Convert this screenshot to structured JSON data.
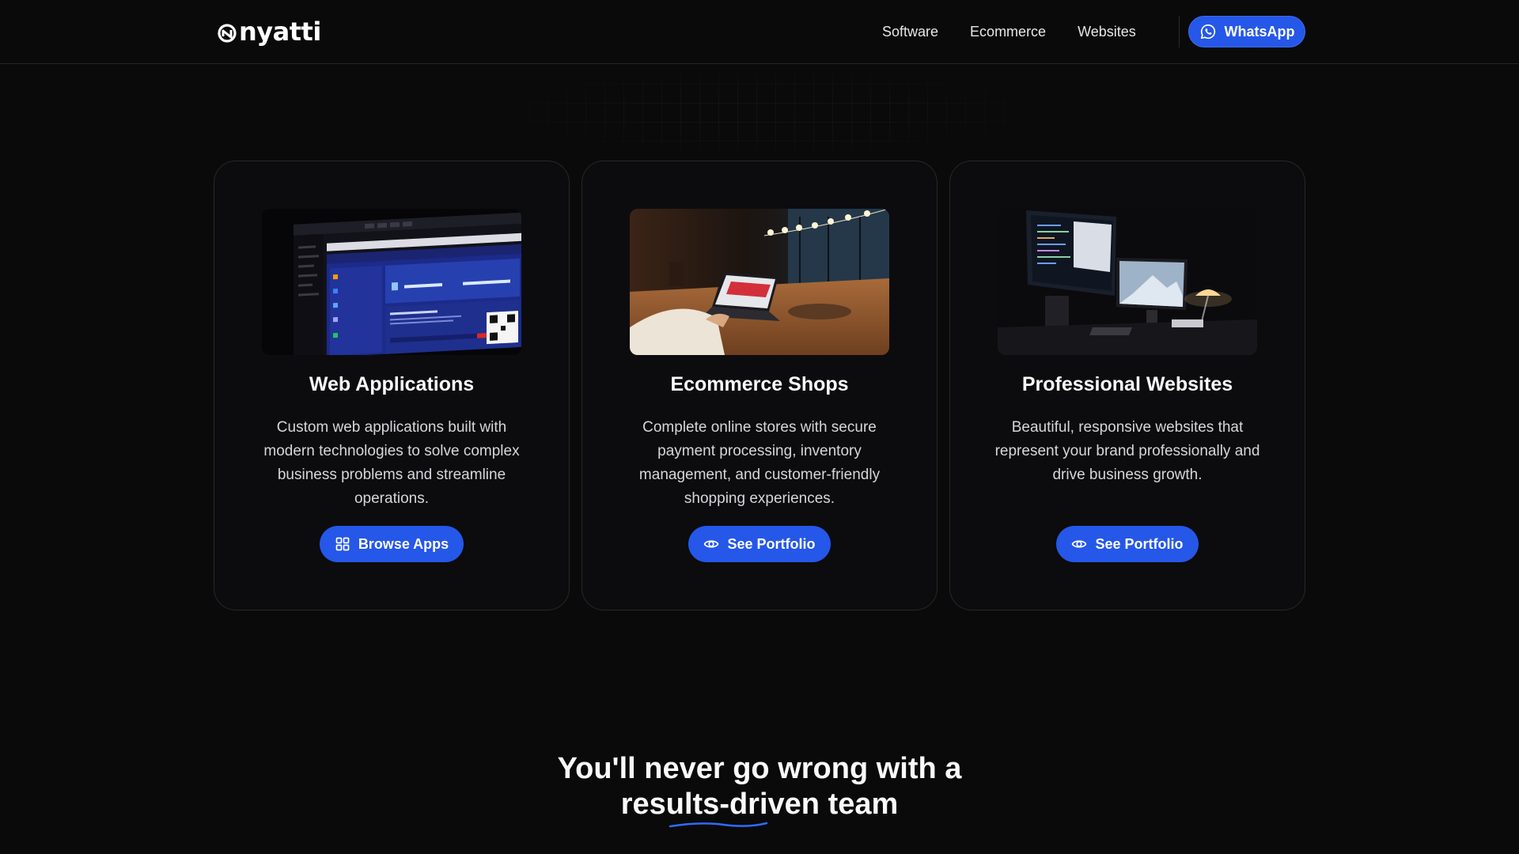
{
  "header": {
    "logo_text": "nyatti",
    "nav": [
      "Software",
      "Ecommerce",
      "Websites"
    ],
    "whatsapp_label": "WhatsApp"
  },
  "cards": [
    {
      "title": "Web Applications",
      "description": "Custom web applications built with modern technologies to solve complex business problems and streamline operations.",
      "button_label": "Browse Apps",
      "button_icon": "grid-icon"
    },
    {
      "title": "Ecommerce Shops",
      "description": "Complete online stores with secure payment processing, inventory management, and customer-friendly shopping experiences.",
      "button_label": "See Portfolio",
      "button_icon": "eye-icon"
    },
    {
      "title": "Professional Websites",
      "description": "Beautiful, responsive websites that represent your brand professionally and drive business growth.",
      "button_label": "See Portfolio",
      "button_icon": "eye-icon"
    }
  ],
  "headline": {
    "line1": "You'll never go wrong with a",
    "line2": "results-driven team"
  },
  "colors": {
    "background": "#0a0a0b",
    "accent": "#2557e8",
    "card_border": "#27272b"
  }
}
